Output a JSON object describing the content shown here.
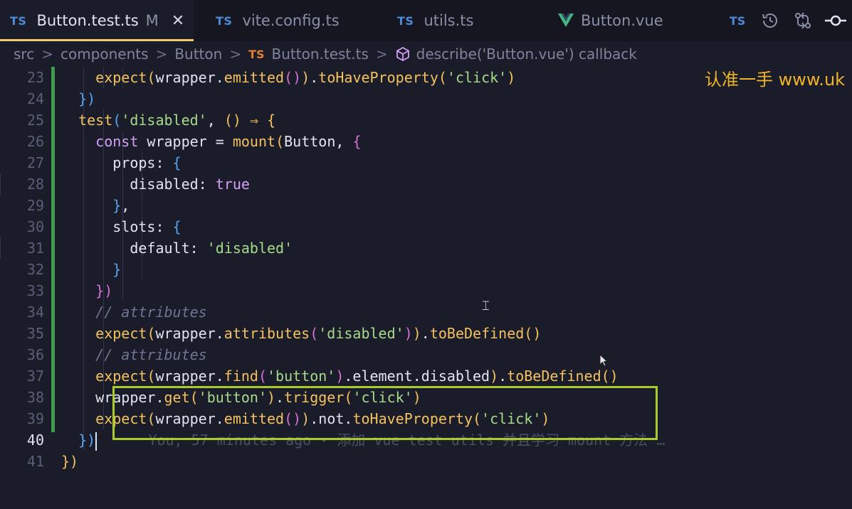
{
  "tabs": [
    {
      "badge": "TS",
      "label": "Button.test.ts",
      "modified": "M",
      "close": "✕"
    },
    {
      "badge": "TS",
      "label": "vite.config.ts"
    },
    {
      "badge": "TS",
      "label": "utils.ts"
    },
    {
      "badge": "vue-logo",
      "label": "Button.vue"
    }
  ],
  "toolbar": {
    "ts_badge": "TS",
    "icons": [
      "history-icon",
      "compare-icon",
      "git-commit-icon"
    ]
  },
  "breadcrumb": {
    "items": [
      "src",
      "components",
      "Button"
    ],
    "file_badge": "TS",
    "file": "Button.test.ts",
    "symbol": "describe('Button.vue') callback",
    "separator": ">"
  },
  "watermark": "认准一手  www.uk",
  "blame": "You, 57 minutes ago • 添加 vue test utils 并且学习 mount 方法 …",
  "colors": {
    "accent": "#f0cc6e",
    "highlight_box": "#a8cc2d",
    "git_added": "#3f9e4a",
    "ts_blue": "#4d8bd6",
    "ts_orange": "#e07e2f"
  },
  "lines": [
    {
      "n": "23",
      "t": [
        [
          "pl",
          "    "
        ],
        [
          "fn",
          "expect"
        ],
        [
          "br1",
          "("
        ],
        [
          "pl",
          "wrapper."
        ],
        [
          "fn",
          "emitted"
        ],
        [
          "br2",
          "()"
        ],
        [
          "br1",
          ")"
        ],
        [
          "pl",
          "."
        ],
        [
          "fn",
          "toHaveProperty"
        ],
        [
          "br1",
          "("
        ],
        [
          "str",
          "'click'"
        ],
        [
          "br1",
          ")"
        ]
      ]
    },
    {
      "n": "24",
      "t": [
        [
          "pl",
          "  "
        ],
        [
          "br3",
          "})"
        ]
      ]
    },
    {
      "n": "25",
      "t": [
        [
          "pl",
          "  "
        ],
        [
          "fn",
          "test"
        ],
        [
          "br3",
          "("
        ],
        [
          "str",
          "'disabled'"
        ],
        [
          "pl",
          ", "
        ],
        [
          "br1",
          "()"
        ],
        [
          "pl",
          " "
        ],
        [
          "arrow",
          "⇒"
        ],
        [
          "pl",
          " "
        ],
        [
          "br1",
          "{"
        ]
      ]
    },
    {
      "n": "26",
      "t": [
        [
          "pl",
          "    "
        ],
        [
          "kw",
          "const"
        ],
        [
          "pl",
          " wrapper = "
        ],
        [
          "fn",
          "mount"
        ],
        [
          "br1",
          "("
        ],
        [
          "pl",
          "Button, "
        ],
        [
          "br2",
          "{"
        ]
      ]
    },
    {
      "n": "27",
      "t": [
        [
          "pl",
          "      props: "
        ],
        [
          "br3",
          "{"
        ]
      ]
    },
    {
      "n": "28",
      "t": [
        [
          "pl",
          "        disabled: "
        ],
        [
          "bool",
          "true"
        ]
      ]
    },
    {
      "n": "29",
      "t": [
        [
          "pl",
          "      "
        ],
        [
          "br3",
          "}"
        ],
        [
          "pl",
          ","
        ]
      ]
    },
    {
      "n": "30",
      "t": [
        [
          "pl",
          "      slots: "
        ],
        [
          "br3",
          "{"
        ]
      ]
    },
    {
      "n": "31",
      "t": [
        [
          "pl",
          "        default: "
        ],
        [
          "str",
          "'disabled'"
        ]
      ]
    },
    {
      "n": "32",
      "t": [
        [
          "pl",
          "      "
        ],
        [
          "br3",
          "}"
        ]
      ]
    },
    {
      "n": "33",
      "t": [
        [
          "pl",
          "    "
        ],
        [
          "br2",
          "})"
        ]
      ]
    },
    {
      "n": "34",
      "t": [
        [
          "pl",
          "    "
        ],
        [
          "cm",
          "// attributes"
        ]
      ]
    },
    {
      "n": "35",
      "t": [
        [
          "pl",
          "    "
        ],
        [
          "fn",
          "expect"
        ],
        [
          "br1",
          "("
        ],
        [
          "pl",
          "wrapper."
        ],
        [
          "fn",
          "attributes"
        ],
        [
          "br2",
          "("
        ],
        [
          "str",
          "'disabled'"
        ],
        [
          "br2",
          ")"
        ],
        [
          "br1",
          ")"
        ],
        [
          "pl",
          "."
        ],
        [
          "fn",
          "toBeDefined"
        ],
        [
          "br1",
          "()"
        ]
      ]
    },
    {
      "n": "36",
      "t": [
        [
          "pl",
          "    "
        ],
        [
          "cm",
          "// attributes"
        ]
      ]
    },
    {
      "n": "37",
      "t": [
        [
          "pl",
          "    "
        ],
        [
          "fn",
          "expect"
        ],
        [
          "br1",
          "("
        ],
        [
          "pl",
          "wrapper."
        ],
        [
          "fn",
          "find"
        ],
        [
          "br2",
          "("
        ],
        [
          "str",
          "'button'"
        ],
        [
          "br2",
          ")"
        ],
        [
          "pl",
          ".element.disabled"
        ],
        [
          "br1",
          ")"
        ],
        [
          "pl",
          "."
        ],
        [
          "fn",
          "toBeDefined"
        ],
        [
          "br1",
          "()"
        ]
      ]
    },
    {
      "n": "38",
      "t": [
        [
          "pl",
          "    wrapper."
        ],
        [
          "fn",
          "get"
        ],
        [
          "br1",
          "("
        ],
        [
          "str",
          "'button'"
        ],
        [
          "br1",
          ")"
        ],
        [
          "pl",
          "."
        ],
        [
          "fn",
          "trigger"
        ],
        [
          "br1",
          "("
        ],
        [
          "str",
          "'click'"
        ],
        [
          "br1",
          ")"
        ]
      ]
    },
    {
      "n": "39",
      "t": [
        [
          "pl",
          "    "
        ],
        [
          "fn",
          "expect"
        ],
        [
          "br1",
          "("
        ],
        [
          "pl",
          "wrapper."
        ],
        [
          "fn",
          "emitted"
        ],
        [
          "br2",
          "()"
        ],
        [
          "br1",
          ")"
        ],
        [
          "pl",
          ".not."
        ],
        [
          "fn",
          "toHaveProperty"
        ],
        [
          "br1",
          "("
        ],
        [
          "str",
          "'click'"
        ],
        [
          "br1",
          ")"
        ]
      ]
    },
    {
      "n": "40",
      "t": [
        [
          "pl",
          "  "
        ],
        [
          "br3",
          "})"
        ],
        [
          "cursor",
          ""
        ],
        [
          "pl",
          "      "
        ],
        [
          "blame",
          "You, 57 minutes ago • 添加 vue test utils 并且学习 mount 方法 …"
        ]
      ]
    },
    {
      "n": "41",
      "t": [
        [
          "br1",
          "})"
        ]
      ]
    }
  ]
}
